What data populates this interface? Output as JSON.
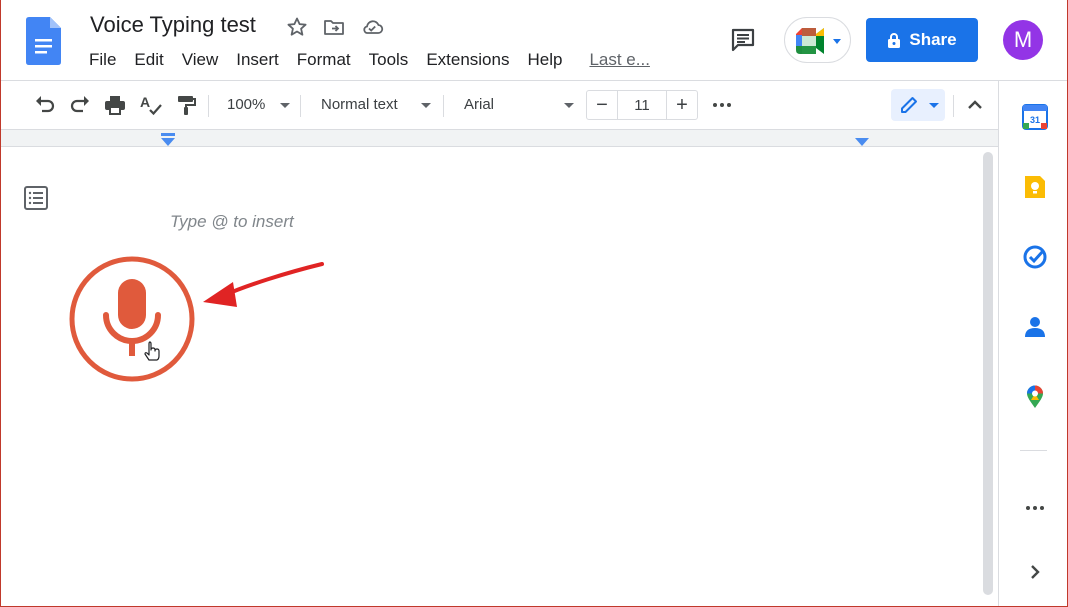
{
  "document": {
    "title": "Voice Typing test",
    "placeholder": "Type @ to insert"
  },
  "menu": {
    "items": [
      "File",
      "Edit",
      "View",
      "Insert",
      "Format",
      "Tools",
      "Extensions",
      "Help"
    ],
    "last_edit": "Last e..."
  },
  "header": {
    "share_label": "Share",
    "avatar_letter": "M"
  },
  "toolbar": {
    "zoom": "100%",
    "style": "Normal text",
    "font": "Arial",
    "font_size": "11",
    "decrease": "−",
    "increase": "+"
  },
  "side_panel": {
    "calendar_day": "31"
  },
  "icons": [
    "docs-logo",
    "star-icon",
    "move-folder-icon",
    "cloud-saved-icon",
    "comment-icon",
    "meet-icon",
    "lock-icon",
    "undo-icon",
    "redo-icon",
    "print-icon",
    "spellcheck-icon",
    "paint-format-icon",
    "more-icon",
    "pencil-icon",
    "chevron-up-icon",
    "outline-icon",
    "mic-icon",
    "calendar-icon",
    "keep-icon",
    "tasks-icon",
    "contacts-icon",
    "maps-icon",
    "chevron-right-icon"
  ],
  "colors": {
    "share_blue": "#1a73e8",
    "mic_red": "#e05a3c",
    "arrow_red": "#e02424",
    "avatar_purple": "#9334e6"
  }
}
